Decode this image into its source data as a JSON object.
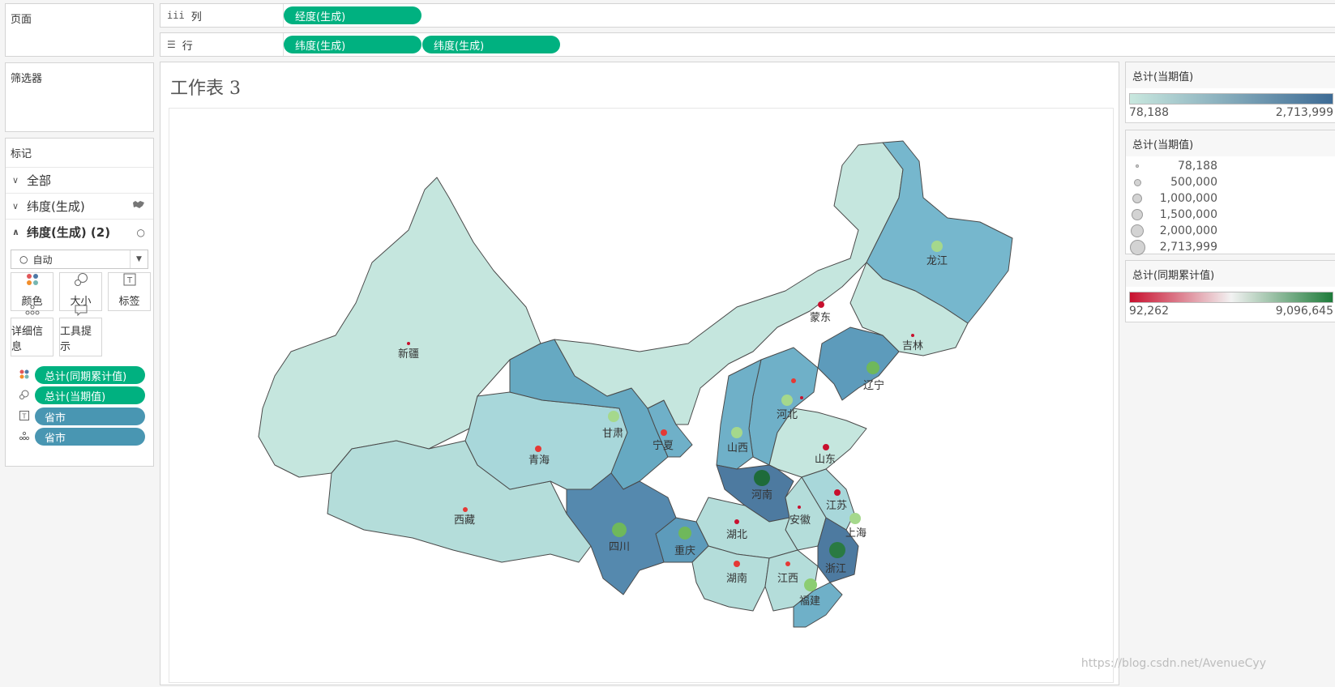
{
  "panels": {
    "pages_title": "页面",
    "filters_title": "筛选器",
    "marks_title": "标记"
  },
  "shelves": {
    "columns_label": "列",
    "rows_label": "行",
    "columns_pills": [
      "经度(生成)"
    ],
    "rows_pills": [
      "纬度(生成)",
      "纬度(生成)"
    ]
  },
  "marks": {
    "all": "全部",
    "layer1": "纬度(生成)",
    "layer2": "纬度(生成) (2)",
    "mark_type": "自动",
    "tiles": {
      "color": "颜色",
      "size": "大小",
      "label": "标签",
      "detail": "详细信息",
      "tooltip": "工具提示"
    },
    "fields": [
      {
        "name": "总计(同期累计值)",
        "color": "#00b180",
        "icon": "color-icon"
      },
      {
        "name": "总计(当期值)",
        "color": "#00b180",
        "icon": "size-icon"
      },
      {
        "name": "省市",
        "color": "#4996b2",
        "icon": "label-icon"
      },
      {
        "name": "省市",
        "color": "#4996b2",
        "icon": "detail-icon"
      }
    ]
  },
  "sheet": {
    "title": "工作表 3"
  },
  "legends": {
    "fill": {
      "title": "总计(当期值)",
      "min": "78,188",
      "max": "2,713,999",
      "color_from": "#c9e8df",
      "color_to": "#3d6b95"
    },
    "size": {
      "title": "总计(当期值)",
      "values": [
        "78,188",
        "500,000",
        "1,000,000",
        "1,500,000",
        "2,000,000",
        "2,713,999"
      ]
    },
    "color": {
      "title": "总计(同期累计值)",
      "min": "92,262",
      "max": "9,096,645",
      "color_low": "#c8102e",
      "color_mid": "#f2f2f2",
      "color_high": "#1e7b3a"
    }
  },
  "map": {
    "regions": [
      "新疆",
      "西藏",
      "青海",
      "甘肃",
      "宁夏",
      "蒙东",
      "龙江",
      "吉林",
      "辽宁",
      "河北",
      "山西",
      "山东",
      "河南",
      "江苏",
      "安徽",
      "上海",
      "浙江",
      "湖北",
      "湖南",
      "江西",
      "福建",
      "四川",
      "重庆"
    ]
  },
  "watermark": "https://blog.csdn.net/AvenueCyy"
}
